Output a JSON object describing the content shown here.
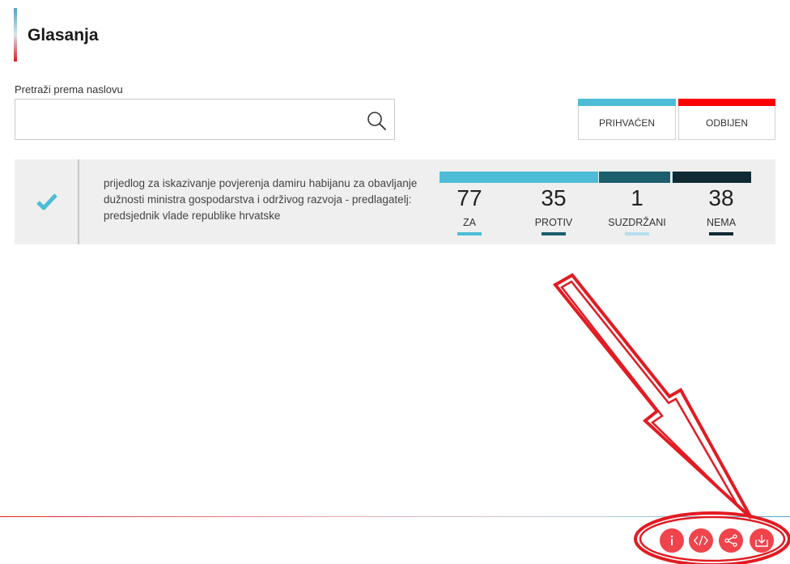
{
  "page": {
    "title": "Glasanja"
  },
  "search": {
    "label": "Pretraži prema naslovu",
    "value": "",
    "placeholder": ""
  },
  "filters": {
    "accepted_label": "PRIHVAĆEN",
    "rejected_label": "ODBIJEN"
  },
  "votes": [
    {
      "title": "prijedlog za iskazivanje povjerenja damiru habijanu za obavljanje dužnosti ministra gospodarstva i održivog razvoja - predlagatelj: predsjednik vlade republike hrvatske",
      "status": "accepted",
      "counts": [
        {
          "label": "ZA",
          "value": "77"
        },
        {
          "label": "PROTIV",
          "value": "35"
        },
        {
          "label": "SUZDRŽANI",
          "value": "1"
        },
        {
          "label": "NEMA",
          "value": "38"
        }
      ]
    }
  ],
  "colors": {
    "za": "#4ebcd6",
    "protiv": "#1d5e6e",
    "suzdrzani": "#b7dff0",
    "nema": "#0f2a33",
    "accent_red": "#f0444c",
    "annotation": "#e21b22"
  },
  "footer": {
    "icons": [
      "info-icon",
      "embed-code-icon",
      "share-icon",
      "download-icon"
    ]
  }
}
